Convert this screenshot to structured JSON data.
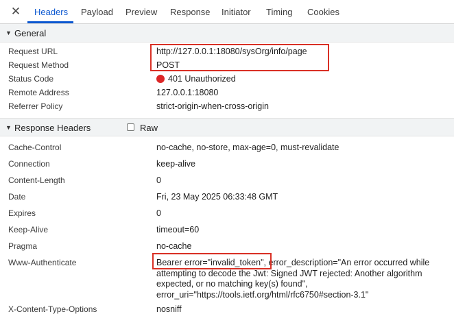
{
  "tabs": {
    "close_glyph": "✕",
    "items": [
      "Headers",
      "Payload",
      "Preview",
      "Response",
      "Initiator",
      "Timing",
      "Cookies"
    ]
  },
  "general": {
    "arrow": "▼",
    "title": "General",
    "rows": [
      {
        "key": "Request URL",
        "value": "http://127.0.0.1:18080/sysOrg/info/page"
      },
      {
        "key": "Request Method",
        "value": "POST"
      },
      {
        "key": "Status Code",
        "value": "401 Unauthorized"
      },
      {
        "key": "Remote Address",
        "value": "127.0.0.1:18080"
      },
      {
        "key": "Referrer Policy",
        "value": "strict-origin-when-cross-origin"
      }
    ],
    "status_dot_color": "#dc2626"
  },
  "response_headers": {
    "arrow": "▼",
    "title": "Response Headers",
    "raw_label": "Raw",
    "raw_checked": false,
    "rows": [
      {
        "key": "Cache-Control",
        "value": "no-cache, no-store, max-age=0, must-revalidate"
      },
      {
        "key": "Connection",
        "value": "keep-alive"
      },
      {
        "key": "Content-Length",
        "value": "0"
      },
      {
        "key": "Date",
        "value": "Fri, 23 May 2025 06:33:48 GMT"
      },
      {
        "key": "Expires",
        "value": "0"
      },
      {
        "key": "Keep-Alive",
        "value": "timeout=60"
      },
      {
        "key": "Pragma",
        "value": "no-cache"
      },
      {
        "key": "Www-Authenticate",
        "value_part1": "Bearer error=\"invalid_token\"",
        "value_part2": ", error_description=\"An error occurred while attempting to decode the Jwt: Signed JWT rejected: Another algorithm expected, or no matching key(s) found\", error_uri=\"https://tools.ietf.org/html/rfc6750#section-3.1\""
      },
      {
        "key": "X-Content-Type-Options",
        "value": "nosniff"
      }
    ]
  },
  "highlight_color": "#d93025"
}
